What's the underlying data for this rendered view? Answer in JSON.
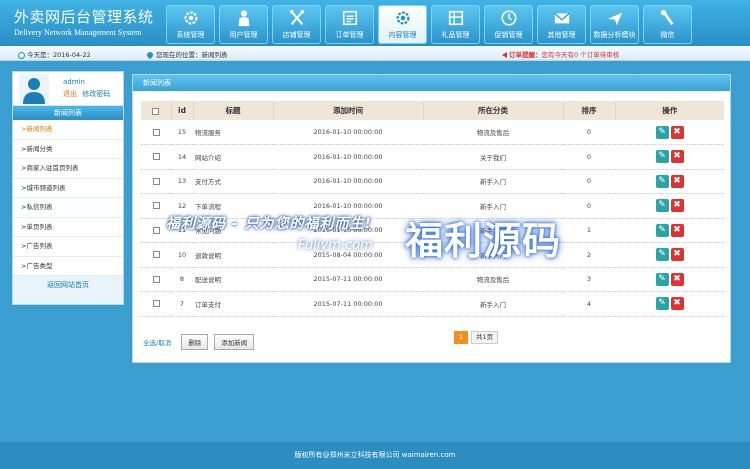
{
  "header": {
    "logo_cn": "外卖网后台管理系统",
    "logo_en": "Delivery Network Management System",
    "nav": [
      {
        "label": "系统管理",
        "icon": "gear-icon"
      },
      {
        "label": "用户管理",
        "icon": "user-icon"
      },
      {
        "label": "店铺管理",
        "icon": "tools-icon"
      },
      {
        "label": "订单管理",
        "icon": "cart-icon"
      },
      {
        "label": "内容管理",
        "icon": "settings-icon"
      },
      {
        "label": "礼品管理",
        "icon": "gift-icon"
      },
      {
        "label": "促销管理",
        "icon": "clock-icon"
      },
      {
        "label": "其他管理",
        "icon": "mail-icon"
      },
      {
        "label": "数据分析模块",
        "icon": "plane-icon"
      },
      {
        "label": "微信",
        "icon": "wrench-icon"
      }
    ]
  },
  "infobar": {
    "date": "今天是：2016-04-22",
    "location": "您现在的位置：新闻列表",
    "notice_prefix": "订单提醒：",
    "notice_text": "您有今天有0 个订单待审核"
  },
  "sidebar": {
    "username": "admin",
    "logout": "退出",
    "change_pwd": "修改密码",
    "title": "新闻列表",
    "items": [
      "新闻列表",
      "新闻分类",
      "商家入驻首页列表",
      "城市频道列表",
      "私信列表",
      "单页列表",
      "广告列表",
      "广告类型"
    ],
    "back": "返回网站首页"
  },
  "main": {
    "title": "新闻列表",
    "columns": [
      "id",
      "标题",
      "添加时间",
      "所在分类",
      "排序",
      "操作"
    ],
    "rows": [
      {
        "id": "15",
        "title": "物流服务",
        "time": "2016-01-10 00:00:00",
        "category": "物流及售后",
        "sort": "0"
      },
      {
        "id": "14",
        "title": "网站介绍",
        "time": "2016-01-10 00:00:00",
        "category": "关于我们",
        "sort": "0"
      },
      {
        "id": "13",
        "title": "支付方式",
        "time": "2016-01-10 00:00:00",
        "category": "新手入门",
        "sort": "0"
      },
      {
        "id": "12",
        "title": "下单流程",
        "time": "2016-01-10 00:00:00",
        "category": "新手入门",
        "sort": "0"
      },
      {
        "id": "11",
        "title": "常见问题",
        "time": "2016-01-10 00:00:00",
        "category": "新手入门",
        "sort": "1"
      },
      {
        "id": "10",
        "title": "退款说明",
        "time": "2015-08-04 00:00:00",
        "category": "新手入门",
        "sort": "2"
      },
      {
        "id": "8",
        "title": "配送说明",
        "time": "2015-07-11 00:00:00",
        "category": "物流及售后",
        "sort": "3"
      },
      {
        "id": "7",
        "title": "订单支付",
        "time": "2015-07-11 00:00:00",
        "category": "新手入门",
        "sort": "4"
      }
    ],
    "select_all": "全选/取消",
    "delete_btn": "删除",
    "add_btn": "添加新闻",
    "page_current": "1",
    "page_total": "共1页"
  },
  "watermark": {
    "line1": "福利源码 - 只为您的福利而生!",
    "line2": "Fuliym.com",
    "big": "福利源码"
  },
  "footer": {
    "text": "版权所有@郑州米立科技有限公司 waimairen.com"
  }
}
